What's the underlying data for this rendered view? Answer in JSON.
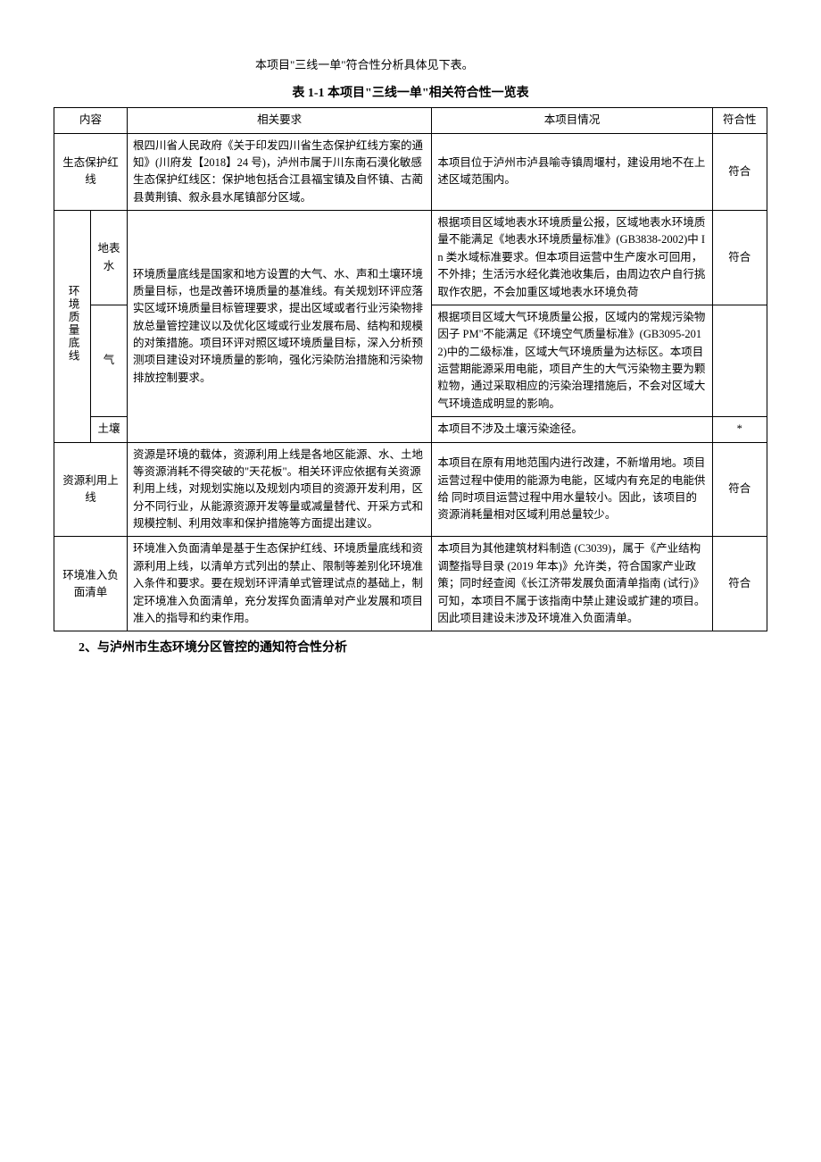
{
  "intro": "本项目\"三线一单\"符合性分析具体见下表。",
  "tableTitle": "表 1-1 本项目\"三线一单\"相关符合性一览表",
  "headers": {
    "category": "内容",
    "requirement": "相关要求",
    "project": "本项目情况",
    "conformity": "符合性"
  },
  "rows": {
    "eco": {
      "cat": "生态保护红线",
      "req": "根四川省人民政府《关于印发四川省生态保护红线方案的通知》(川府发【2018】24 号)，泸州市属于川东南石漠化敏感生态保护红线区：保护地包括合江县福宝镇及自怀镇、古蔺县黄荆镇、叙永县水尾镇部分区域。",
      "proj": "本项目位于泸州市泸县喻寺镇周堰村，建设用地不在上述区域范围内。",
      "conf": "符合"
    },
    "envGroup": "环境质量底线",
    "envReq": "环境质量底线是国家和地方设置的大气、水、声和土壤环境质量目标，也是改善环境质量的基准线。有关规划环评应落实区域环境质量目标管理要求，提出区域或者行业污染物排放总量管控建议以及优化区域或行业发展布局、结构和规模的对策措施。项目环评对照区域环境质量目标，深入分析预测项目建设对环境质量的影响，强化污染防治措施和污染物排放控制要求。",
    "surfaceWater": {
      "cat": "地表水",
      "proj": "根据项目区域地表水环境质量公报，区域地表水环境质量不能满足《地表水环境质量标准》(GB3838-2002)中 In 类水域标准要求。但本项目运营中生产废水可回用，不外排；生活污水经化粪池收集后，由周边农户自行挑取作农肥，不会加重区域地表水环境负荷",
      "conf": "符合"
    },
    "air": {
      "cat": "气",
      "proj": "根据项目区域大气环境质量公报，区域内的常规污染物因子 PM\"不能满足《环境空气质量标准》(GB3095-2012)中的二级标准，区域大气环境质量为达标区。本项目运营期能源采用电能，项目产生的大气污染物主要为颗粒物，通过采取相应的污染治理措施后，不会对区域大气环境造成明显的影响。",
      "conf": ""
    },
    "soil": {
      "cat": "土壤",
      "proj": "本项目不涉及土壤污染途径。",
      "conf": "*"
    },
    "resource": {
      "cat": "资源利用上线",
      "req": "资源是环境的载体，资源利用上线是各地区能源、水、土地等资源消耗不得突破的\"天花板\"。相关环评应依据有关资源利用上线，对规划实施以及规划内项目的资源开发利用，区分不同行业，从能源资源开发等量或减量替代、开采方式和规模控制、利用效率和保护措施等方面提出建议。",
      "proj": "本项目在原有用地范围内进行改建，不新增用地。项目运营过程中使用的能源为电能，区域内有充足的电能供给 同时项目运营过程中用水量较小。因此，该项目的资源消耗量相对区域利用总量较少。",
      "conf": "符合"
    },
    "negative": {
      "cat": "环境准入负面清单",
      "req": "环境准入负面清单是基于生态保护红线、环境质量底线和资源利用上线，以清单方式列出的禁止、限制等差别化环境准入条件和要求。要在规划环评清单式管理试点的基础上，制定环境准入负面清单，充分发挥负面清单对产业发展和项目准入的指导和约束作用。",
      "proj": "本项目为其他建筑材料制造 (C3039)，属于《产业结构调整指导目录 (2019 年本)》允许类，符合国家产业政策；同时经查阅《长江济带发展负面清单指南 (试行)》可知，本项目不属于该指南中禁止建设或扩建的项目。因此项目建设未涉及环境准入负面清单。",
      "conf": "符合"
    }
  },
  "section2": "2、与泸州市生态环境分区管控的通知符合性分析"
}
